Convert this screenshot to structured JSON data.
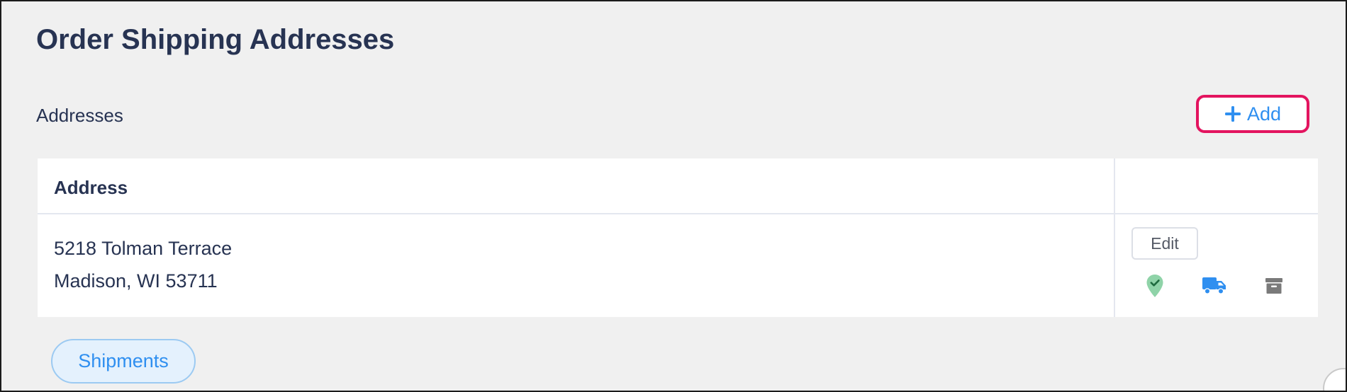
{
  "page": {
    "title": "Order Shipping Addresses"
  },
  "addresses_section": {
    "label": "Addresses",
    "add_button_label": "Add"
  },
  "table": {
    "columns": [
      "Address",
      ""
    ],
    "rows": [
      {
        "address_line1": "5218 Tolman Terrace",
        "address_line2": "Madison, WI 53711",
        "edit_label": "Edit",
        "icons": [
          "location-check-icon",
          "truck-icon",
          "archive-icon"
        ]
      }
    ]
  },
  "footer": {
    "shipments_label": "Shipments"
  },
  "colors": {
    "accent_blue": "#2f8ff0",
    "title_navy": "#273352",
    "highlight_pink": "#e3145f",
    "location_green": "#8fd3a8",
    "archive_gray": "#7a7a7a"
  }
}
